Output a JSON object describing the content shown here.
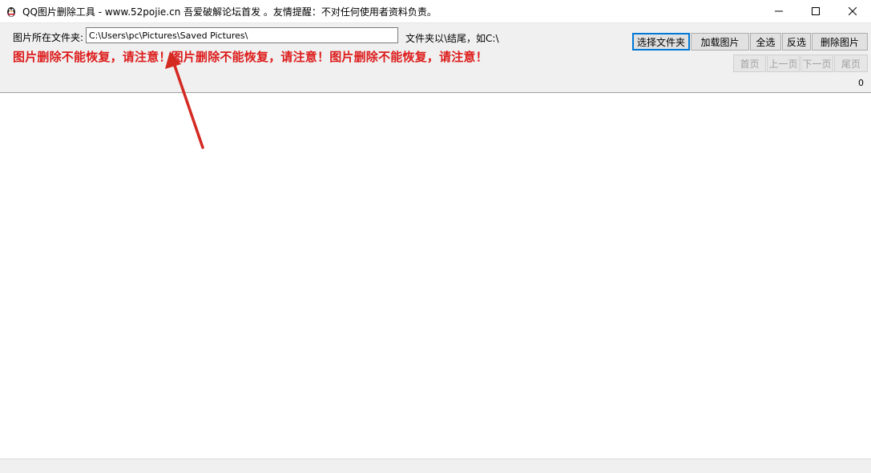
{
  "window": {
    "title": "QQ图片删除工具 - www.52pojie.cn 吾爱破解论坛首发 。友情提醒：不对任何使用者资料负责。"
  },
  "form": {
    "folder_label": "图片所在文件夹:",
    "path_value": "C:\\Users\\pc\\Pictures\\Saved Pictures\\",
    "hint": "文件夹以\\结尾，如C:\\",
    "warning": "图片删除不能恢复，请注意！图片删除不能恢复，请注意！图片删除不能恢复，请注意！"
  },
  "buttons": {
    "select_folder": "选择文件夹",
    "load_images": "加载图片",
    "select_all": "全选",
    "invert_selection": "反选",
    "delete_images": "删除图片"
  },
  "pager": {
    "first": "首页",
    "prev": "上一页",
    "next": "下一页",
    "last": "尾页",
    "count": "0"
  },
  "colors": {
    "warning": "#dd1c1c",
    "arrow": "#d42a22",
    "focus_border": "#0078d7"
  }
}
